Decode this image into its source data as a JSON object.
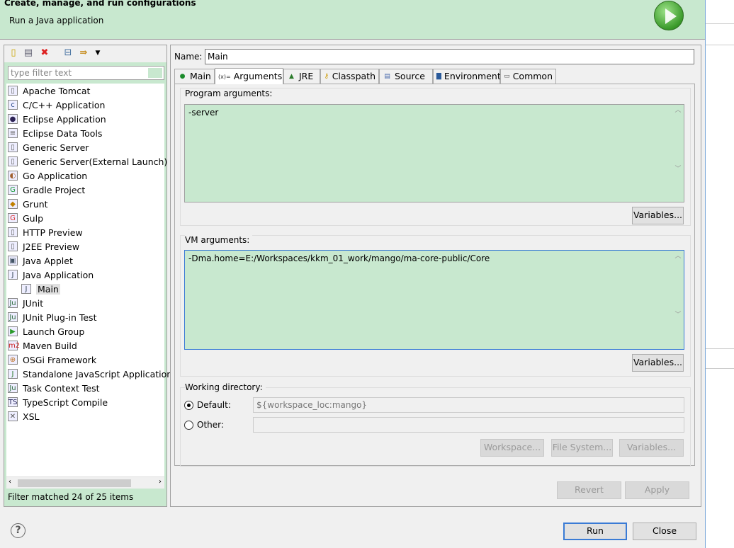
{
  "header": {
    "title": "Create, manage, and run configurations",
    "subtitle": "Run a Java application"
  },
  "left": {
    "filter_placeholder": "type filter text",
    "items": [
      {
        "label": "Apache Tomcat",
        "icon": "server-icon"
      },
      {
        "label": "C/C++ Application",
        "icon": "c-icon"
      },
      {
        "label": "Eclipse Application",
        "icon": "eclipse-icon"
      },
      {
        "label": "Eclipse Data Tools",
        "icon": "database-icon"
      },
      {
        "label": "Generic Server",
        "icon": "server-icon"
      },
      {
        "label": "Generic Server(External Launch)",
        "icon": "server-icon"
      },
      {
        "label": "Go Application",
        "icon": "gopher-icon"
      },
      {
        "label": "Gradle Project",
        "icon": "gradle-icon"
      },
      {
        "label": "Grunt",
        "icon": "grunt-icon"
      },
      {
        "label": "Gulp",
        "icon": "gulp-icon"
      },
      {
        "label": "HTTP Preview",
        "icon": "server-icon"
      },
      {
        "label": "J2EE Preview",
        "icon": "server-icon"
      },
      {
        "label": "Java Applet",
        "icon": "applet-icon"
      },
      {
        "label": "Java Application",
        "icon": "java-app-icon"
      },
      {
        "label": "Main",
        "icon": "java-app-icon",
        "child": true,
        "selected": true
      },
      {
        "label": "JUnit",
        "icon": "junit-icon"
      },
      {
        "label": "JUnit Plug-in Test",
        "icon": "junit-icon"
      },
      {
        "label": "Launch Group",
        "icon": "launch-group-icon"
      },
      {
        "label": "Maven Build",
        "icon": "maven-icon"
      },
      {
        "label": "OSGi Framework",
        "icon": "osgi-icon"
      },
      {
        "label": "Standalone JavaScript Application",
        "icon": "js-icon"
      },
      {
        "label": "Task Context Test",
        "icon": "junit-icon"
      },
      {
        "label": "TypeScript Compile",
        "icon": "ts-icon"
      },
      {
        "label": "XSL",
        "icon": "xsl-icon"
      }
    ],
    "status": "Filter matched 24 of 25 items"
  },
  "config": {
    "name_label": "Name:",
    "name_value": "Main",
    "tabs": [
      {
        "label": "Main",
        "icon": "main-tab-icon"
      },
      {
        "label": "Arguments",
        "icon": "arguments-icon",
        "active": true
      },
      {
        "label": "JRE",
        "icon": "jre-icon"
      },
      {
        "label": "Classpath",
        "icon": "classpath-icon"
      },
      {
        "label": "Source",
        "icon": "source-icon"
      },
      {
        "label": "Environment",
        "icon": "environment-icon"
      },
      {
        "label": "Common",
        "icon": "common-icon"
      }
    ],
    "program_args_label": "Program arguments:",
    "program_args": "-server",
    "vm_args_label": "VM arguments:",
    "vm_args": "-Dma.home=E:/Workspaces/kkm_01_work/mango/ma-core-public/Core",
    "variables": "Variables...",
    "workdir_label": "Working directory:",
    "default_label": "Default:",
    "default_value": "${workspace_loc:mango}",
    "other_label": "Other:",
    "workspace_btn": "Workspace...",
    "filesystem_btn": "File System...",
    "revert": "Revert",
    "apply": "Apply"
  },
  "footer": {
    "run": "Run",
    "close": "Close",
    "help": "?"
  }
}
